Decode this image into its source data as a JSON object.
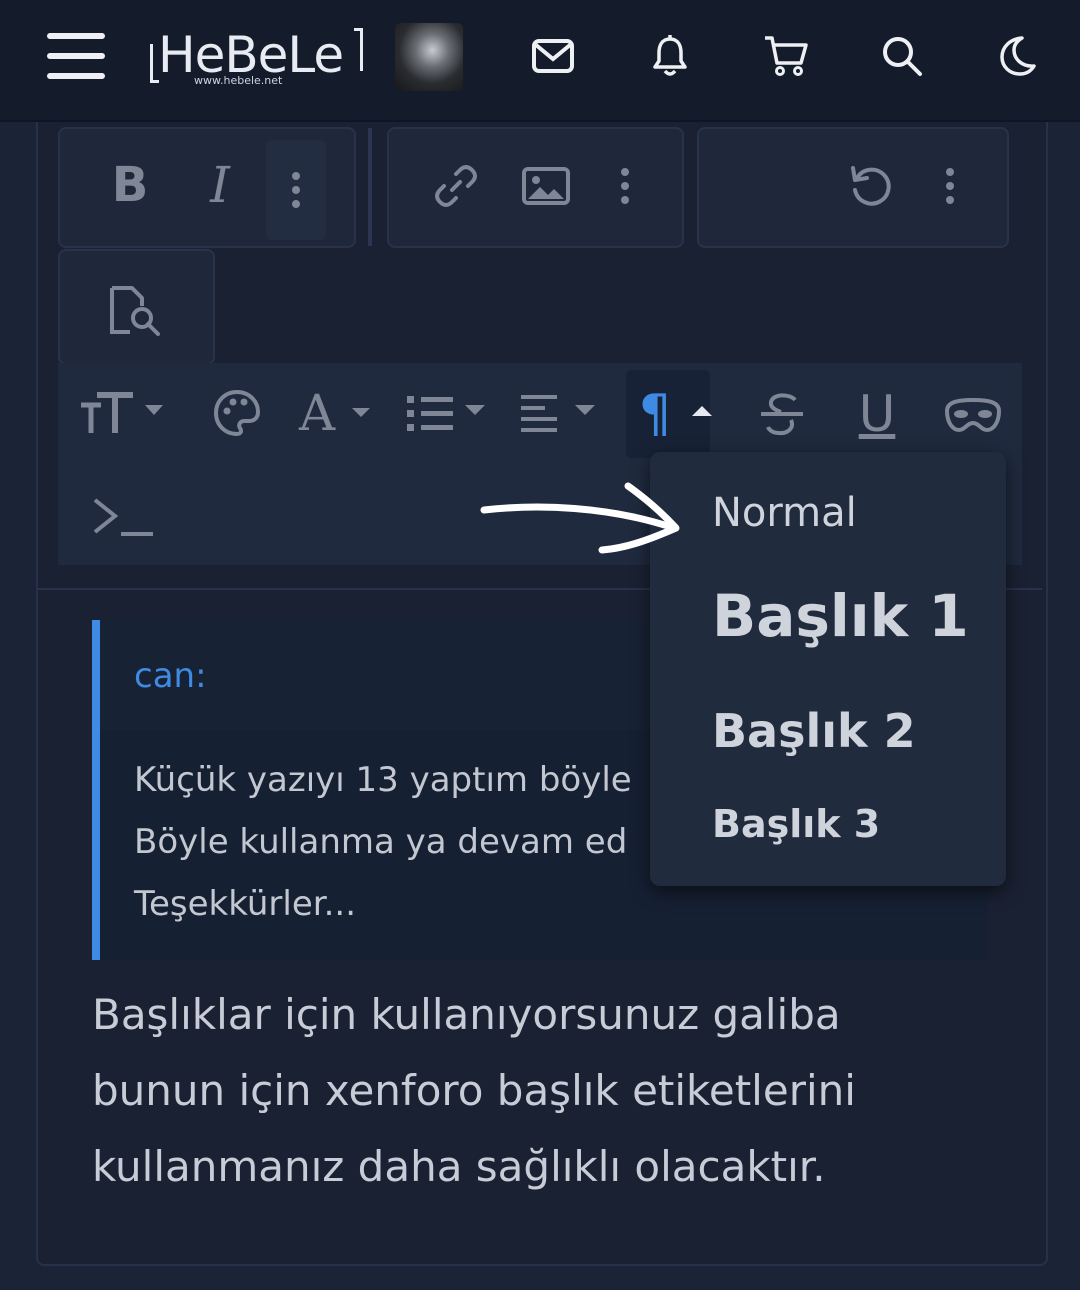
{
  "header": {
    "logo_text": "HeBeLe",
    "logo_url_text": "www.hebele.net",
    "icons": [
      "menu-icon",
      "mail-icon",
      "bell-icon",
      "cart-icon",
      "search-icon",
      "moon-icon"
    ]
  },
  "editor": {
    "toolbar_row1": [
      "bold",
      "italic",
      "more",
      "link",
      "image",
      "more",
      "undo",
      "more",
      "preview"
    ],
    "bold_label": "B",
    "italic_label": "I",
    "toolbar_row2": [
      "text-size",
      "palette",
      "font",
      "list",
      "align",
      "paragraph",
      "strikethrough",
      "underline",
      "spoiler",
      "code"
    ],
    "font_label": "A",
    "underline_label": "U",
    "paragraph_label": "¶",
    "code_label": ">_",
    "active_color": "#3f8ae3"
  },
  "paragraph_menu": {
    "items": [
      {
        "label": "Normal"
      },
      {
        "label": "Başlık 1"
      },
      {
        "label": "Başlık 2"
      },
      {
        "label": "Başlık 3"
      }
    ]
  },
  "quote": {
    "author": "can:",
    "lines": [
      "Küçük yazıyı 13 yaptım böyle",
      "Böyle kullanma ya devam ed",
      "Teşekkürler..."
    ]
  },
  "reply": {
    "lines": [
      "Başlıklar için kullanıyorsunuz galiba",
      "bunun için xenforo başlık etiketlerini",
      "kullanmanız daha sağlıklı olacaktır."
    ]
  }
}
